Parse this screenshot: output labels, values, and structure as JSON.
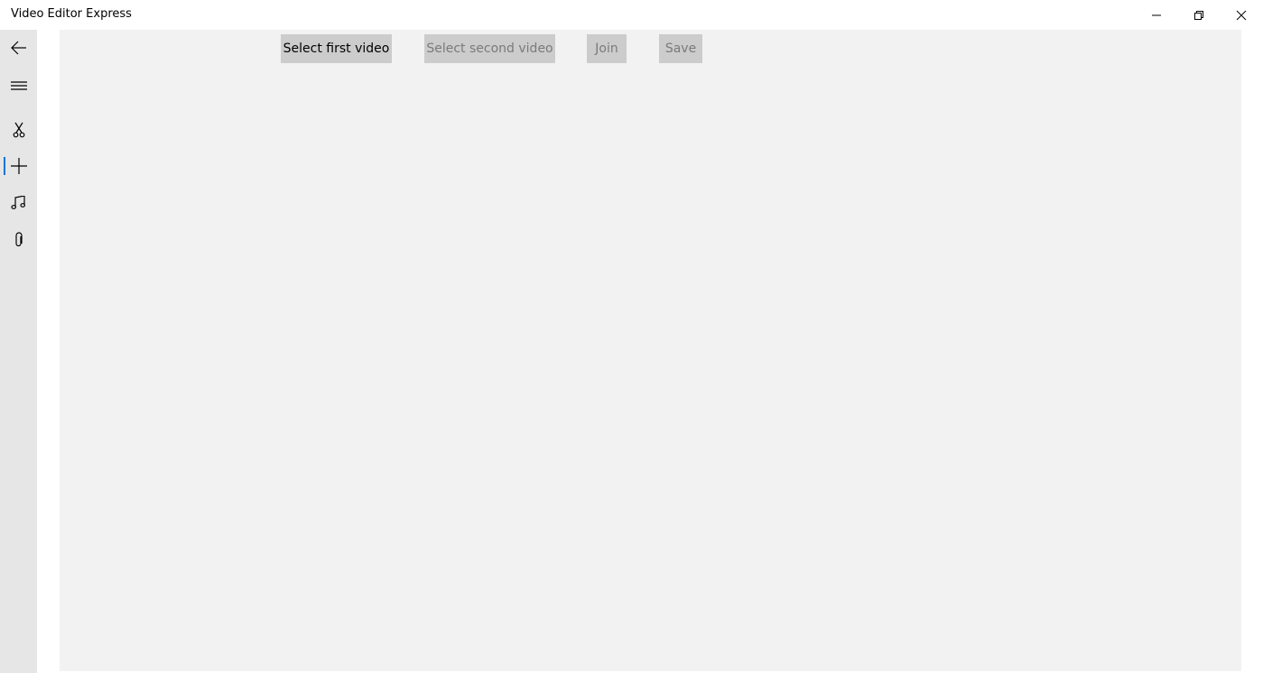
{
  "window": {
    "title": "Video Editor Express",
    "controls": {
      "minimize_icon": "minimize-icon",
      "maximize_icon": "restore-icon",
      "close_icon": "close-icon"
    }
  },
  "nav": {
    "items": [
      {
        "icon": "back-arrow-icon"
      },
      {
        "icon": "hamburger-menu-icon"
      },
      {
        "icon": "scissors-icon"
      },
      {
        "icon": "plus-icon",
        "selected": true
      },
      {
        "icon": "music-note-icon"
      },
      {
        "icon": "paperclip-icon"
      }
    ],
    "accent_color": "#0078d7"
  },
  "toolbar": {
    "select_first_label": "Select first video",
    "select_second_label": "Select second video",
    "join_label": "Join",
    "save_label": "Save"
  }
}
